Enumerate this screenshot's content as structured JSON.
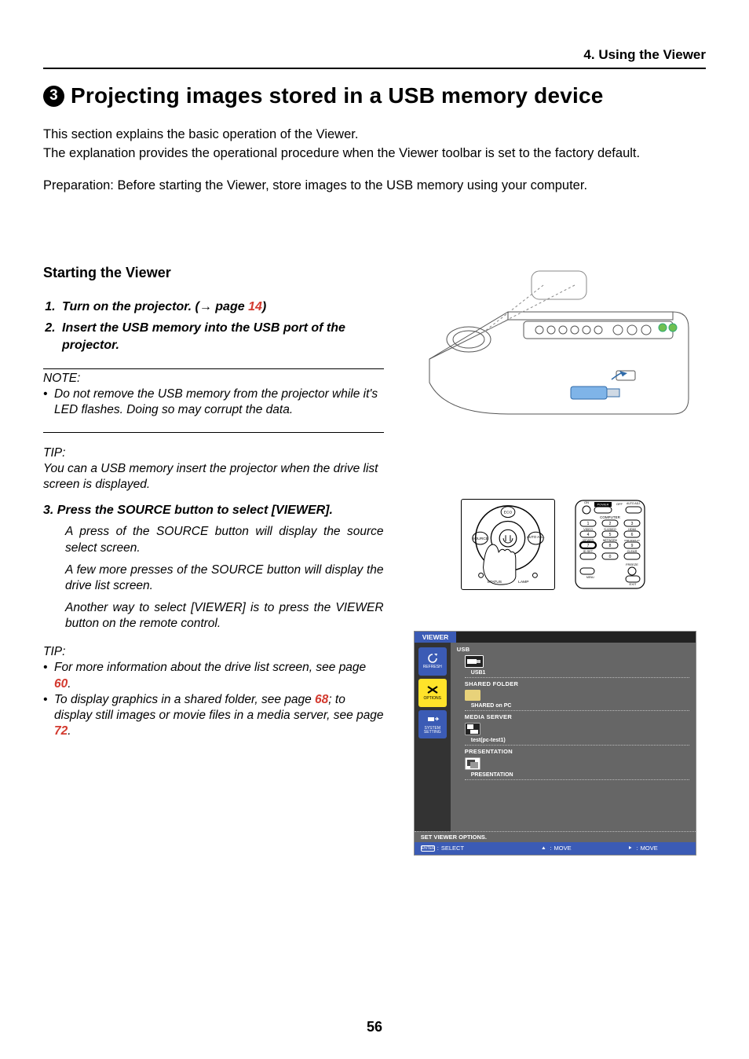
{
  "header": {
    "chapter": "4. Using the Viewer"
  },
  "title": {
    "num": "3",
    "text": "Projecting images stored in a USB memory device"
  },
  "intro": {
    "p1": "This section explains the basic operation of the Viewer.",
    "p2": "The explanation provides the operational procedure when the Viewer toolbar is set to the factory default.",
    "p3": "Preparation: Before starting the Viewer, store images to the USB memory using your computer."
  },
  "subhead": "Starting the Viewer",
  "steps": {
    "s1a": "Turn on the projector. (",
    "s1b": " page ",
    "s1page": "14",
    "s1c": ")",
    "s2": "Insert the USB memory into the USB port of the projector."
  },
  "note": {
    "label": "NOTE:",
    "b1": "Do not remove the USB memory from the projector while it's LED flashes. Doing so may corrupt the data."
  },
  "tip1": {
    "label": "TIP:",
    "text": "You can a USB memory insert the projector when the drive list screen is displayed."
  },
  "step3": {
    "title": "3.  Press the SOURCE button to select [VIEWER].",
    "p1": "A press of the SOURCE button will display the source select screen.",
    "p2": "A few more presses of the SOURCE button will display the drive list screen.",
    "p3": "Another way to select [VIEWER] is to press the VIEWER button on the remote control."
  },
  "tip2": {
    "label": "TIP:",
    "b1a": "For more information about the drive list screen, see page ",
    "b1page": "60",
    "b1b": ".",
    "b2a": "To display graphics in a shared folder, see page ",
    "b2page1": "68",
    "b2b": "; to display still images or movie files in a media server, see page ",
    "b2page2": "72",
    "b2c": "."
  },
  "panel": {
    "source_label": "SOURCE",
    "eco_label": "ECO",
    "auto_label": "AUTO ADJ.",
    "status": "STATUS",
    "lamp": "LAMP"
  },
  "remote": {
    "on": "ON",
    "power": "POWER",
    "off": "OFF",
    "autoadj": "AUTO ADJ.",
    "computer": "COMPUTER",
    "r1": "1",
    "r2": "2",
    "r3": "3",
    "video": "VIDEO",
    "svideo": "S-VIDEO",
    "hdmi": "HDMI",
    "r4": "4",
    "r5": "5",
    "r6": "6",
    "viewer": "VIEWER",
    "network": "NETWORK",
    "usbdisp": "USB DISPLAY",
    "r7": "7",
    "r8": "8",
    "r9": "9",
    "idset": "ID SET",
    "r0": "0",
    "clear": "CLEAR",
    "freeze": "FREEZE",
    "menu": "MENU",
    "exit": "EXIT"
  },
  "viewer": {
    "tab": "VIEWER",
    "side": {
      "refresh": "REFRESH",
      "options": "OPTIONS",
      "systemsetting": "SYSTEM SETTING"
    },
    "usb_h": "USB",
    "usb_item": "USB1",
    "shared_h": "SHARED FOLDER",
    "shared_item": "SHARED on PC",
    "media_h": "MEDIA SERVER",
    "media_item": "test(pc-test1)",
    "pres_h": "PRESENTATION",
    "pres_item": "PRESENTATION",
    "footer_left": "SET VIEWER OPTIONS.",
    "guide": {
      "select": "SELECT",
      "moveL": "MOVE",
      "moveR": "MOVE",
      "enter": "ENTER"
    }
  },
  "page_number": "56"
}
